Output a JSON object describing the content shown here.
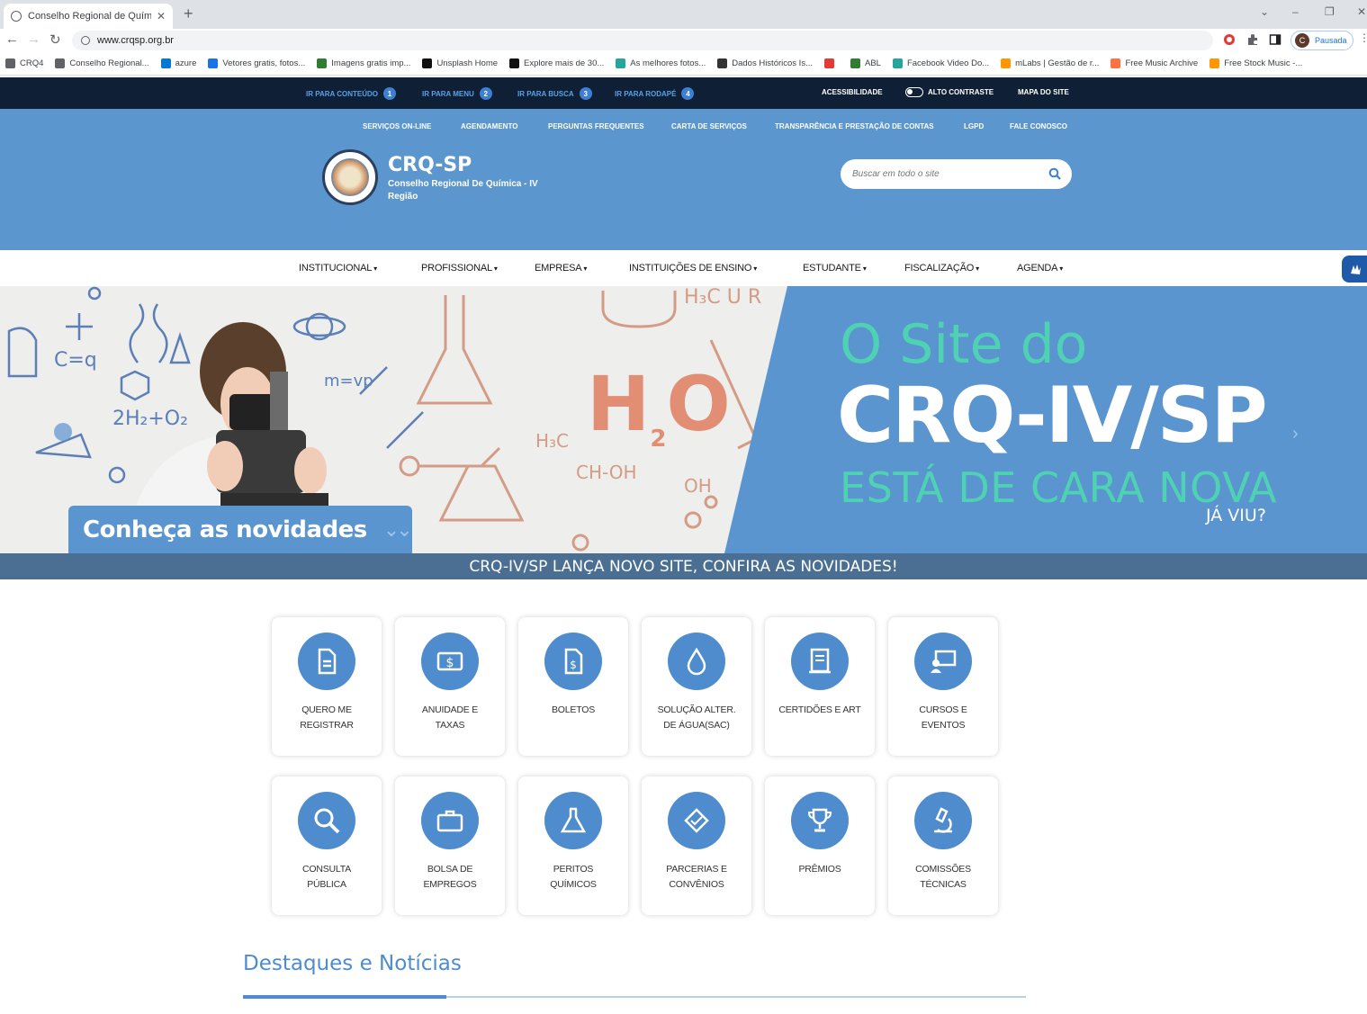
{
  "browser": {
    "tab_title": "Conselho Regional de Química -",
    "url": "www.crqsp.org.br",
    "profile_label": "Pausada",
    "profile_initial": "C",
    "bookmarks": [
      {
        "label": "CRQ4",
        "color": "#5f6368"
      },
      {
        "label": "Conselho Regional...",
        "color": "#5f6368"
      },
      {
        "label": "azure",
        "color": "#0078d4"
      },
      {
        "label": "Vetores gratis, fotos...",
        "color": "#1a73e8"
      },
      {
        "label": "Imagens gratis imp...",
        "color": "#2e7d32"
      },
      {
        "label": "Unsplash Home",
        "color": "#111111"
      },
      {
        "label": "Explore mais de 30...",
        "color": "#111111"
      },
      {
        "label": "As melhores fotos...",
        "color": "#26a69a"
      },
      {
        "label": "Dados Históricos Is...",
        "color": "#333333"
      },
      {
        "label": "",
        "color": "#e53935"
      },
      {
        "label": "ABL",
        "color": "#2e7d32"
      },
      {
        "label": "Facebook Video Do...",
        "color": "#26a69a"
      },
      {
        "label": "mLabs | Gestão de r...",
        "color": "#ff9800"
      },
      {
        "label": "Free Music Archive",
        "color": "#ff7043"
      },
      {
        "label": "Free Stock Music -...",
        "color": "#ff9800"
      }
    ]
  },
  "skip_links": [
    {
      "label": "IR PARA CONTEÚDO",
      "num": "1"
    },
    {
      "label": "IR PARA MENU",
      "num": "2"
    },
    {
      "label": "IR PARA BUSCA",
      "num": "3"
    },
    {
      "label": "IR PARA RODAPÉ",
      "num": "4"
    }
  ],
  "top_right": {
    "accessibility": "ACESSIBILIDADE",
    "high_contrast": "ALTO CONTRASTE",
    "sitemap": "MAPA DO SITE"
  },
  "service_nav": [
    "SERVIÇOS ON-LINE",
    "AGENDAMENTO",
    "PERGUNTAS FREQUENTES",
    "CARTA DE SERVIÇOS",
    "TRANSPARÊNCIA E PRESTAÇÃO DE CONTAS",
    "LGPD",
    "FALE CONOSCO"
  ],
  "brand": {
    "name": "CRQ-SP",
    "subtitle": "Conselho Regional De Química - IV Região"
  },
  "search": {
    "placeholder": "Buscar em todo o site"
  },
  "main_nav": [
    "INSTITUCIONAL",
    "PROFISSIONAL",
    "EMPRESA",
    "INSTITUIÇÕES DE ENSINO",
    "ESTUDANTE",
    "FISCALIZAÇÃO",
    "AGENDA"
  ],
  "hero": {
    "line1": "O Site do",
    "line2": "CRQ-IV/SP",
    "line3": "ESTÁ DE CARA NOVA",
    "line4": "JÁ VIU?",
    "h2o": "H",
    "h2o_sub": "2",
    "h2o_end": "O",
    "cta": "Conheça as novidades",
    "caption": "CRQ-IV/SP LANÇA NOVO SITE, CONFIRA AS NOVIDADES!"
  },
  "tiles": [
    {
      "label1": "QUERO ME",
      "label2": "REGISTRAR",
      "icon": "document-icon"
    },
    {
      "label1": "ANUIDADE E",
      "label2": "TAXAS",
      "icon": "money-icon"
    },
    {
      "label1": "BOLETOS",
      "label2": "",
      "icon": "invoice-icon"
    },
    {
      "label1": "SOLUÇÃO ALTER.",
      "label2": "DE ÁGUA(SAC)",
      "icon": "water-drop-icon"
    },
    {
      "label1": "CERTIDÕES E ART",
      "label2": "",
      "icon": "certificate-icon"
    },
    {
      "label1": "CURSOS E",
      "label2": "EVENTOS",
      "icon": "presentation-icon"
    },
    {
      "label1": "CONSULTA",
      "label2": "PÚBLICA",
      "icon": "magnifier-icon"
    },
    {
      "label1": "BOLSA DE",
      "label2": "EMPREGOS",
      "icon": "briefcase-icon"
    },
    {
      "label1": "PERITOS",
      "label2": "QUÍMICOS",
      "icon": "flask-icon"
    },
    {
      "label1": "PARCERIAS E",
      "label2": "CONVÊNIOS",
      "icon": "handshake-icon"
    },
    {
      "label1": "PRÊMIOS",
      "label2": "",
      "icon": "trophy-icon"
    },
    {
      "label1": "COMISSÕES",
      "label2": "TÉCNICAS",
      "icon": "microscope-icon"
    }
  ],
  "section_title": "Destaques e Notícias",
  "colors": {
    "primary": "#5b96cf",
    "dark": "#0f2036",
    "accent": "#4fd1b3",
    "tile_icon": "#4e8ccd"
  }
}
